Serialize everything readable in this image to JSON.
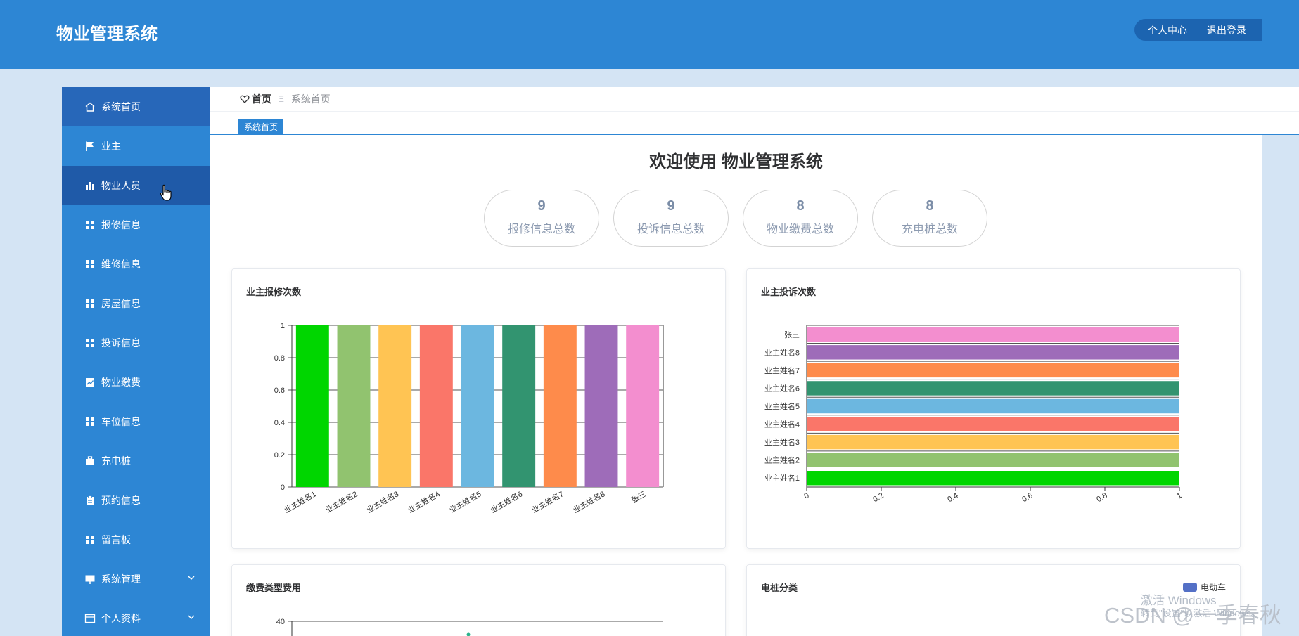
{
  "header": {
    "title": "物业管理系统",
    "actions": [
      "个人中心",
      "退出登录"
    ]
  },
  "sidebar": {
    "items": [
      {
        "label": "系统首页",
        "icon": "home-icon"
      },
      {
        "label": "业主",
        "icon": "flag-icon"
      },
      {
        "label": "物业人员",
        "icon": "bar-chart-icon"
      },
      {
        "label": "报修信息",
        "icon": "grid-icon"
      },
      {
        "label": "维修信息",
        "icon": "grid-icon"
      },
      {
        "label": "房屋信息",
        "icon": "grid-icon"
      },
      {
        "label": "投诉信息",
        "icon": "grid-icon"
      },
      {
        "label": "物业缴费",
        "icon": "line-chart-icon"
      },
      {
        "label": "车位信息",
        "icon": "grid-icon"
      },
      {
        "label": "充电桩",
        "icon": "briefcase-icon"
      },
      {
        "label": "预约信息",
        "icon": "clipboard-icon"
      },
      {
        "label": "留言板",
        "icon": "grid-icon"
      },
      {
        "label": "系统管理",
        "icon": "monitor-icon"
      },
      {
        "label": "个人资料",
        "icon": "id-card-icon"
      }
    ]
  },
  "breadcrumb": {
    "home": "首页",
    "separator": "Ξ",
    "current": "系统首页"
  },
  "tabs": [
    "系统首页"
  ],
  "welcome": "欢迎使用 物业管理系统",
  "stats": [
    {
      "value": "9",
      "label": "报修信息总数"
    },
    {
      "value": "9",
      "label": "投诉信息总数"
    },
    {
      "value": "8",
      "label": "物业缴费总数"
    },
    {
      "value": "8",
      "label": "充电桩总数"
    }
  ],
  "colors": {
    "header_bg": "#2d86d4",
    "sidebar_active": "#2767b9",
    "bar_palette": [
      "#00d600",
      "#91c36f",
      "#ffc453",
      "#fa7669",
      "#6cb7e0",
      "#329470",
      "#fe8b4b",
      "#9e6cb9",
      "#f38ecf"
    ]
  },
  "chart_data": [
    {
      "type": "bar",
      "title": "业主报修次数",
      "categories": [
        "业主姓名1",
        "业主姓名2",
        "业主姓名3",
        "业主姓名4",
        "业主姓名5",
        "业主姓名6",
        "业主姓名7",
        "业主姓名8",
        "张三"
      ],
      "values": [
        1,
        1,
        1,
        1,
        1,
        1,
        1,
        1,
        1
      ],
      "yticks": [
        "0",
        "0.2",
        "0.4",
        "0.6",
        "0.8",
        "1"
      ],
      "ylim": [
        0,
        1
      ],
      "grid": true
    },
    {
      "type": "bar",
      "orientation": "horizontal",
      "title": "业主投诉次数",
      "categories": [
        "业主姓名1",
        "业主姓名2",
        "业主姓名3",
        "业主姓名4",
        "业主姓名5",
        "业主姓名6",
        "业主姓名7",
        "业主姓名8",
        "张三"
      ],
      "values": [
        1,
        1,
        1,
        1,
        1,
        1,
        1,
        1,
        1
      ],
      "xticks": [
        "0",
        "0.2",
        "0.4",
        "0.6",
        "0.8",
        "1"
      ],
      "xlim": [
        0,
        1
      ],
      "grid": true
    },
    {
      "type": "line",
      "title": "缴费类型费用",
      "yticks": [
        "40"
      ]
    },
    {
      "type": "pie",
      "title": "电桩分类",
      "legend": [
        "电动车"
      ],
      "legend_position": "top-right"
    }
  ],
  "watermark": {
    "line1": "激活 Windows",
    "line2": "转到\"设置\"以激活 Windows。",
    "csdn": "CSDN @一季春秋"
  }
}
